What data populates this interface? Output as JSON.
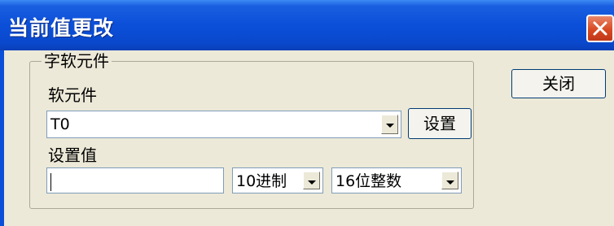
{
  "window": {
    "title": "当前值更改",
    "close_icon": "close-icon"
  },
  "group": {
    "legend": "字软元件",
    "device_label": "软元件",
    "device_value": "T0",
    "setting_value_label": "设置值",
    "setting_value": "",
    "base_select": "10进制",
    "type_select": "16位整数"
  },
  "buttons": {
    "set": "设置",
    "close": "关闭"
  }
}
